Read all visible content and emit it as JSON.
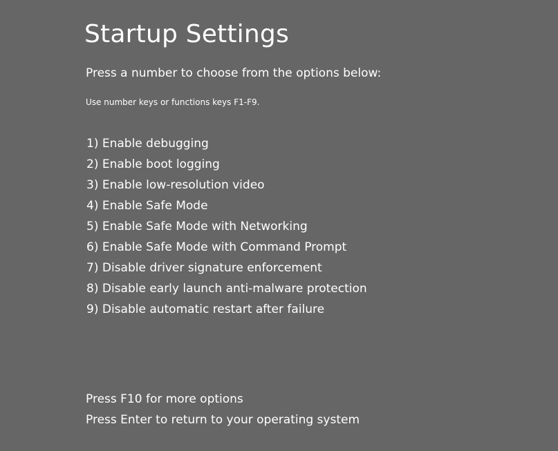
{
  "screen": {
    "background_color": "#666666",
    "text_color": "#ffffff"
  },
  "header": {
    "title": "Startup Settings",
    "instruction": "Press a number to choose from the options below:",
    "hint": "Use number keys or functions keys F1-F9."
  },
  "options": [
    "1) Enable debugging",
    "2) Enable boot logging",
    "3) Enable low-resolution video",
    "4) Enable Safe Mode",
    "5) Enable Safe Mode with Networking",
    "6) Enable Safe Mode with Command Prompt",
    "7) Disable driver signature enforcement",
    "8) Disable early launch anti-malware protection",
    "9) Disable automatic restart after failure"
  ],
  "footer": {
    "more_options": "Press F10 for more options",
    "return_to_os": "Press Enter to return to your operating system"
  }
}
